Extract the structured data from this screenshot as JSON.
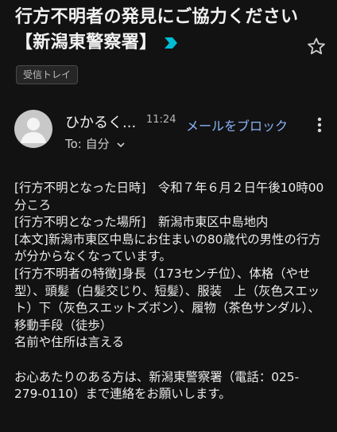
{
  "email": {
    "subject": "行方不明者の発見にご協力ください【新潟東警察署】",
    "label": "受信トレイ",
    "important_icon": "importance-marker-icon",
    "star_icon": "star-outline-icon",
    "sender": {
      "name": "ひかるく...",
      "time": "11:24",
      "block_link": "メールをブロック",
      "recipient": "To: 自分",
      "recipient_icon": "chevron-down-icon",
      "more_icon": "more-vert-icon",
      "avatar_icon": "person-avatar-icon"
    },
    "body": {
      "lines": [
        "[行方不明となった日時]　令和７年６月２日午後10時00分ころ",
        "[行方不明となった場所]　新潟市東区中島地内",
        "[本文]新潟市東区中島にお住まいの80歳代の男性の行方が分からなくなっています。",
        "[行方不明者の特徴]身長（173センチ位）、体格（やせ型）、頭髪（白髪交じり、短髪）、服装　上（灰色スエット）下（灰色スエットズボン）、履物（茶色サンダル）、移動手段（徒歩）",
        "名前や住所は言える"
      ],
      "closing": "お心あたりのある方は、新潟東警察署（電話：025-279-0110）まで連絡をお願いします。"
    }
  },
  "colors": {
    "background": "#121212",
    "accent_link": "#8ab4f8",
    "important_marker": "#00bcd4",
    "avatar_bg": "#c8c8c8"
  }
}
